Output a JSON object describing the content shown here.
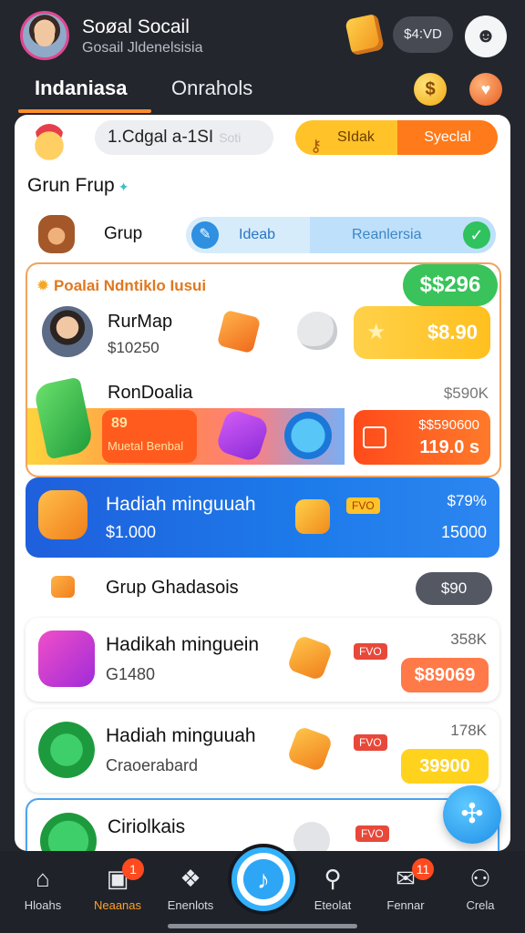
{
  "header": {
    "title": "Soøal Socail",
    "subtitle": "Gosail Jldenelsisia",
    "pill": "$4:VD"
  },
  "tabs": [
    {
      "label": "Indaniasa",
      "active": true
    },
    {
      "label": "Onrahols",
      "active": false
    }
  ],
  "search": {
    "value": "1.Cdgal a-1SI",
    "ghost": "Soti"
  },
  "segment": {
    "left": "SIdak",
    "right": "Syeclal"
  },
  "section_title": "Grun Frup",
  "grup_row": {
    "label": "Grup",
    "mid": "Ideab",
    "right": "Reanlersia"
  },
  "promo": {
    "title": "Poalai Ndntiklo Iusui",
    "price_badge": "$$296",
    "row1": {
      "name": "RurMap",
      "amount": "$10250",
      "gold": "$8.90"
    },
    "row2": {
      "name": "RonDoalia",
      "right": "$590K",
      "orange_num": "89",
      "orange_label": "Muetal Benbal",
      "red_top": "$$590600",
      "red_bottom": "119.0 s"
    }
  },
  "blue_card": {
    "title": "Hadiah minguuah",
    "amount": "$1.000",
    "tag": "FVO",
    "right_top": "$79%",
    "right_bottom": "15000"
  },
  "group2": {
    "label": "Grup Ghadasois",
    "pill": "$90"
  },
  "list": [
    {
      "title": "Hadikah minguein",
      "sub": "G1480",
      "tag": "FVO",
      "right": "358K",
      "btn": "$89069",
      "btn_color": "#ff7a48"
    },
    {
      "title": "Hadiah minguuah",
      "sub": "Craoerabard",
      "tag": "FVO",
      "right": "178K",
      "btn": "39900",
      "btn_color": "#ffd21e"
    },
    {
      "title": "Ciriolkais",
      "sub": "",
      "tag": "FVO",
      "right": "",
      "btn": "",
      "btn_color": "#ffd21e"
    }
  ],
  "nav": [
    {
      "label": "Hloahs",
      "icon": "home-icon",
      "badge": ""
    },
    {
      "label": "Neaanas",
      "icon": "game-icon",
      "badge": "1",
      "active": true
    },
    {
      "label": "Enenlots",
      "icon": "dog-icon",
      "badge": ""
    },
    {
      "label": "",
      "icon": "music-icon",
      "badge": ""
    },
    {
      "label": "Eteolat",
      "icon": "search-icon",
      "badge": ""
    },
    {
      "label": "Fennar",
      "icon": "chat-icon",
      "badge": "11"
    },
    {
      "label": "Crela",
      "icon": "person-icon",
      "badge": ""
    }
  ]
}
